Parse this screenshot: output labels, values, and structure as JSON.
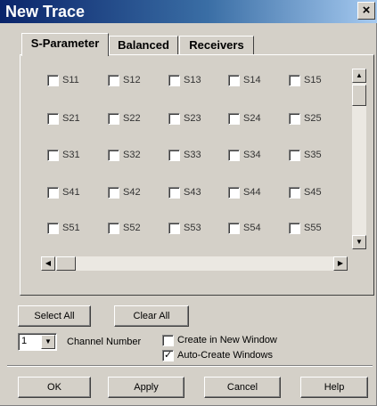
{
  "window": {
    "title": "New Trace",
    "close_label": "✕"
  },
  "tabs": [
    {
      "label": "S-Parameter",
      "active": true
    },
    {
      "label": "Balanced",
      "active": false
    },
    {
      "label": "Receivers",
      "active": false
    }
  ],
  "sparams": [
    [
      "S11",
      "S12",
      "S13",
      "S14",
      "S15"
    ],
    [
      "S21",
      "S22",
      "S23",
      "S24",
      "S25"
    ],
    [
      "S31",
      "S32",
      "S33",
      "S34",
      "S35"
    ],
    [
      "S41",
      "S42",
      "S43",
      "S44",
      "S45"
    ],
    [
      "S51",
      "S52",
      "S53",
      "S54",
      "S55"
    ]
  ],
  "buttons": {
    "select_all": "Select All",
    "clear_all": "Clear All",
    "ok": "OK",
    "apply": "Apply",
    "cancel": "Cancel",
    "help": "Help"
  },
  "channel": {
    "value": "1",
    "label": "Channel Number"
  },
  "options": {
    "create_new_window": {
      "label": "Create in New Window",
      "checked": false
    },
    "auto_create_windows": {
      "label": "Auto-Create Windows",
      "checked": true
    }
  }
}
